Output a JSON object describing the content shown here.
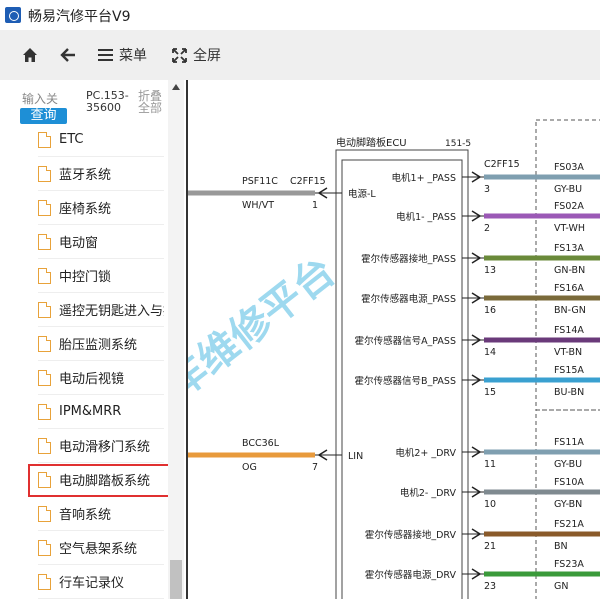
{
  "app": {
    "title": "畅易汽修平台V9"
  },
  "toolbar": {
    "menu_label": "菜单",
    "fullscreen_label": "全屏"
  },
  "search": {
    "placeholder": "输入关",
    "button_label": "查询",
    "code": "PC.153-\n35600",
    "collapse_label": "折叠\n全部"
  },
  "tree": {
    "items": [
      {
        "label": "ETC"
      },
      {
        "label": "蓝牙系统"
      },
      {
        "label": "座椅系统"
      },
      {
        "label": "电动窗"
      },
      {
        "label": "中控门锁"
      },
      {
        "label": "遥控无钥匙进入与控"
      },
      {
        "label": "胎压监测系统"
      },
      {
        "label": "电动后视镜"
      },
      {
        "label": "IPM&MRR"
      },
      {
        "label": "电动滑移门系统"
      },
      {
        "label": "电动脚踏板系统",
        "selected": true
      },
      {
        "label": "音响系统"
      },
      {
        "label": "空气悬架系统"
      },
      {
        "label": "行车记录仪"
      }
    ]
  },
  "diagram": {
    "ecu_title": "电动脚踏板ECU",
    "ecu_page": "151-5",
    "watermark": "车维修平台",
    "left_connector": "C2FF15",
    "left_wires": [
      {
        "wire": "PSF11C",
        "color_code": "WH/VT",
        "pin": "1",
        "signal": "电源-L",
        "color": "#999999"
      },
      {
        "wire": "BCC36L",
        "color_code": "OG",
        "pin": "7",
        "signal": "LIN",
        "color": "#e89a3c"
      }
    ],
    "right_connector": "C2FF15",
    "right_pins": [
      {
        "signal": "电机1+ _PASS",
        "pin": "3",
        "wire": "FS03A",
        "color_code": "GY-BU",
        "color": "#7f9fb0"
      },
      {
        "signal": "电机1- _PASS",
        "pin": "2",
        "wire": "FS02A",
        "color_code": "VT-WH",
        "color": "#9b59b6"
      },
      {
        "signal": "霍尔传感器接地_PASS",
        "pin": "13",
        "wire": "FS13A",
        "color_code": "GN-BN",
        "color": "#6a8a3a"
      },
      {
        "signal": "霍尔传感器电源_PASS",
        "pin": "16",
        "wire": "FS16A",
        "color_code": "BN-GN",
        "color": "#7a6a3a"
      },
      {
        "signal": "霍尔传感器信号A_PASS",
        "pin": "14",
        "wire": "FS14A",
        "color_code": "VT-BN",
        "color": "#6a3a7a"
      },
      {
        "signal": "霍尔传感器信号B_PASS",
        "pin": "15",
        "wire": "FS15A",
        "color_code": "BU-BN",
        "color": "#3aa0d0"
      },
      {
        "signal": "电机2+ _DRV",
        "pin": "11",
        "wire": "FS11A",
        "color_code": "GY-BU",
        "color": "#7f9fb0"
      },
      {
        "signal": "电机2- _DRV",
        "pin": "10",
        "wire": "FS10A",
        "color_code": "GY-BN",
        "color": "#7f8a90"
      },
      {
        "signal": "霍尔传感器接地_DRV",
        "pin": "21",
        "wire": "FS21A",
        "color_code": "BN",
        "color": "#8a5a2a"
      },
      {
        "signal": "霍尔传感器电源_DRV",
        "pin": "23",
        "wire": "FS23A",
        "color_code": "GN",
        "color": "#3a9a3a"
      }
    ]
  }
}
